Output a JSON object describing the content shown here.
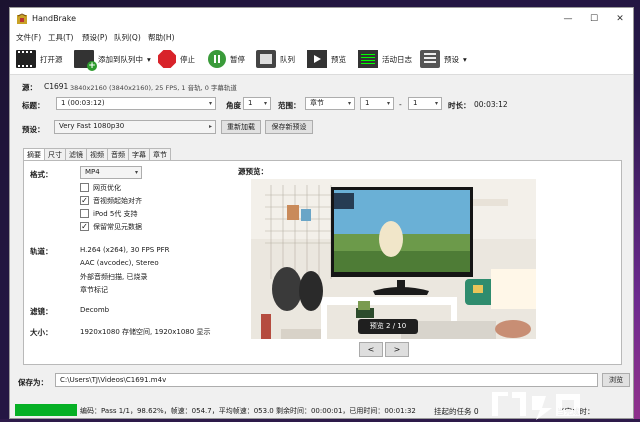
{
  "app": {
    "title": "HandBrake"
  },
  "window_controls": {
    "minimize": "—",
    "maximize": "☐",
    "close": "✕"
  },
  "menu": [
    "文件(F)",
    "工具(T)",
    "预设(P)",
    "队列(Q)",
    "帮助(H)"
  ],
  "toolbar": {
    "open_source": "打开源",
    "add_to_queue": "添加到队列中",
    "stop": "停止",
    "pause": "暂停",
    "queue": "队列",
    "preview": "预览",
    "activity_log": "活动日志",
    "presets": "预设"
  },
  "source": {
    "label": "源：",
    "name": "C1691",
    "info": "3840x2160 (3840x2160), 25 FPS, 1 音轨, 0 字幕轨道"
  },
  "title_row": {
    "title_label": "标题：",
    "title_value": "1 (00:03:12)",
    "angle_label": "角度",
    "angle_value": "1",
    "range_label": "范围：",
    "range_type": "章节",
    "range_start": "1",
    "range_sep": "-",
    "range_end": "1",
    "duration_label": "时长：",
    "duration_value": "00:03:12"
  },
  "preset_row": {
    "label": "预设：",
    "value": "Very Fast 1080p30",
    "reload_button": "重新加载",
    "save_button": "保存新预设"
  },
  "tabs": [
    "摘要",
    "尺寸",
    "滤镜",
    "视频",
    "音频",
    "字幕",
    "章节"
  ],
  "summary": {
    "format_label": "格式：",
    "format_value": "MP4",
    "options": [
      {
        "label": "网页优化",
        "checked": false
      },
      {
        "label": "音视频起始对齐",
        "checked": true
      },
      {
        "label": "iPod 5代 支持",
        "checked": false
      },
      {
        "label": "保留常见元数据",
        "checked": true
      }
    ],
    "tracks_label": "轨道：",
    "tracks": [
      "H.264 (x264), 30 FPS PFR",
      "AAC (avcodec), Stereo",
      "外部音频扫描, 已烧录",
      "章节标记"
    ],
    "filters_label": "滤镜：",
    "filters_value": "Decomb",
    "size_label": "大小：",
    "size_value": "1920x1080 存储空间, 1920x1080 显示",
    "preview_label": "源预览：",
    "preview_badge": "预览 2 / 10",
    "prev_button": "<",
    "next_button": ">"
  },
  "save": {
    "label": "保存为：",
    "path": "C:\\Users\\TJ\\Videos\\C1691.m4v",
    "browse_button": "浏览"
  },
  "status": {
    "progress": 0.9862,
    "text": "编码：Pass 1/1，98.62%，帧速：054.7，平均帧速：053.0 剩余时间：00:00:01，已用时间：00:01:32",
    "queue_text": "挂起的任务 0",
    "when_done": "当完成时："
  },
  "colors": {
    "progress": "#06b025",
    "stop": "#d8232a",
    "pause": "#3a9b3a",
    "accent": "#0078d7"
  }
}
